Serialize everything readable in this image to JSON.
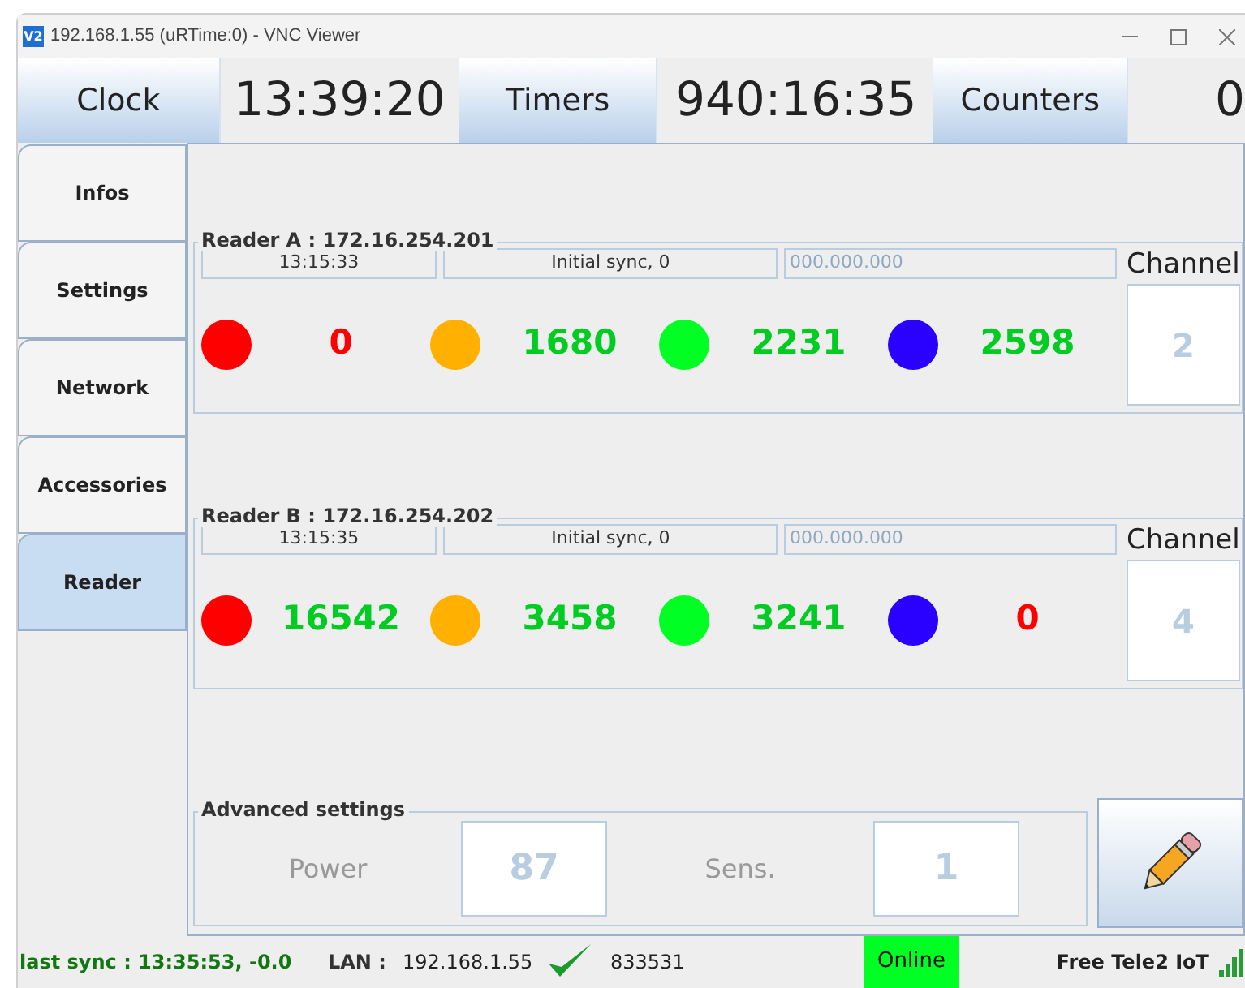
{
  "window": {
    "title": "192.168.1.55 (uRTime:0) - VNC Viewer",
    "logo": "V2"
  },
  "top_bar": [
    {
      "kind": "button",
      "text": "Clock"
    },
    {
      "kind": "display",
      "text": "13:39:20"
    },
    {
      "kind": "button",
      "text": "Timers"
    },
    {
      "kind": "display",
      "text": "940:16:35"
    },
    {
      "kind": "button",
      "text": "Counters"
    },
    {
      "kind": "display",
      "text": "0"
    }
  ],
  "tabs": [
    {
      "label": "Infos",
      "selected": false
    },
    {
      "label": "Settings",
      "selected": false
    },
    {
      "label": "Network",
      "selected": false
    },
    {
      "label": "Accessories",
      "selected": false
    },
    {
      "label": "Reader",
      "selected": true
    }
  ],
  "readers": [
    {
      "title": "Reader A : 172.16.254.201",
      "time": "13:15:33",
      "status": "Initial sync, 0",
      "address_placeholder": "000.000.000",
      "channel_label": "Channel",
      "channel": "2",
      "counters": [
        {
          "color": "#ff0000",
          "value": "0",
          "alert": true
        },
        {
          "color": "#ffb000",
          "value": "1680",
          "alert": false
        },
        {
          "color": "#00ff22",
          "value": "2231",
          "alert": false
        },
        {
          "color": "#2a00ff",
          "value": "2598",
          "alert": false
        }
      ]
    },
    {
      "title": "Reader B : 172.16.254.202",
      "time": "13:15:35",
      "status": "Initial sync, 0",
      "address_placeholder": "000.000.000",
      "channel_label": "Channel",
      "channel": "4",
      "counters": [
        {
          "color": "#ff0000",
          "value": "16542",
          "alert": false
        },
        {
          "color": "#ffb000",
          "value": "3458",
          "alert": false
        },
        {
          "color": "#00ff22",
          "value": "3241",
          "alert": false
        },
        {
          "color": "#2a00ff",
          "value": "0",
          "alert": true
        }
      ]
    }
  ],
  "advanced": {
    "title": "Advanced settings",
    "fields": [
      {
        "label": "Power",
        "value": "87"
      },
      {
        "label": "Sens.",
        "value": "1"
      }
    ]
  },
  "status_bar": {
    "sync": "last sync : 13:35:53, -0.0",
    "lan_label": "LAN :",
    "ip": "192.168.1.55",
    "code": "833531",
    "state": "Online",
    "online": true,
    "network": "Free Tele2 IoT"
  }
}
